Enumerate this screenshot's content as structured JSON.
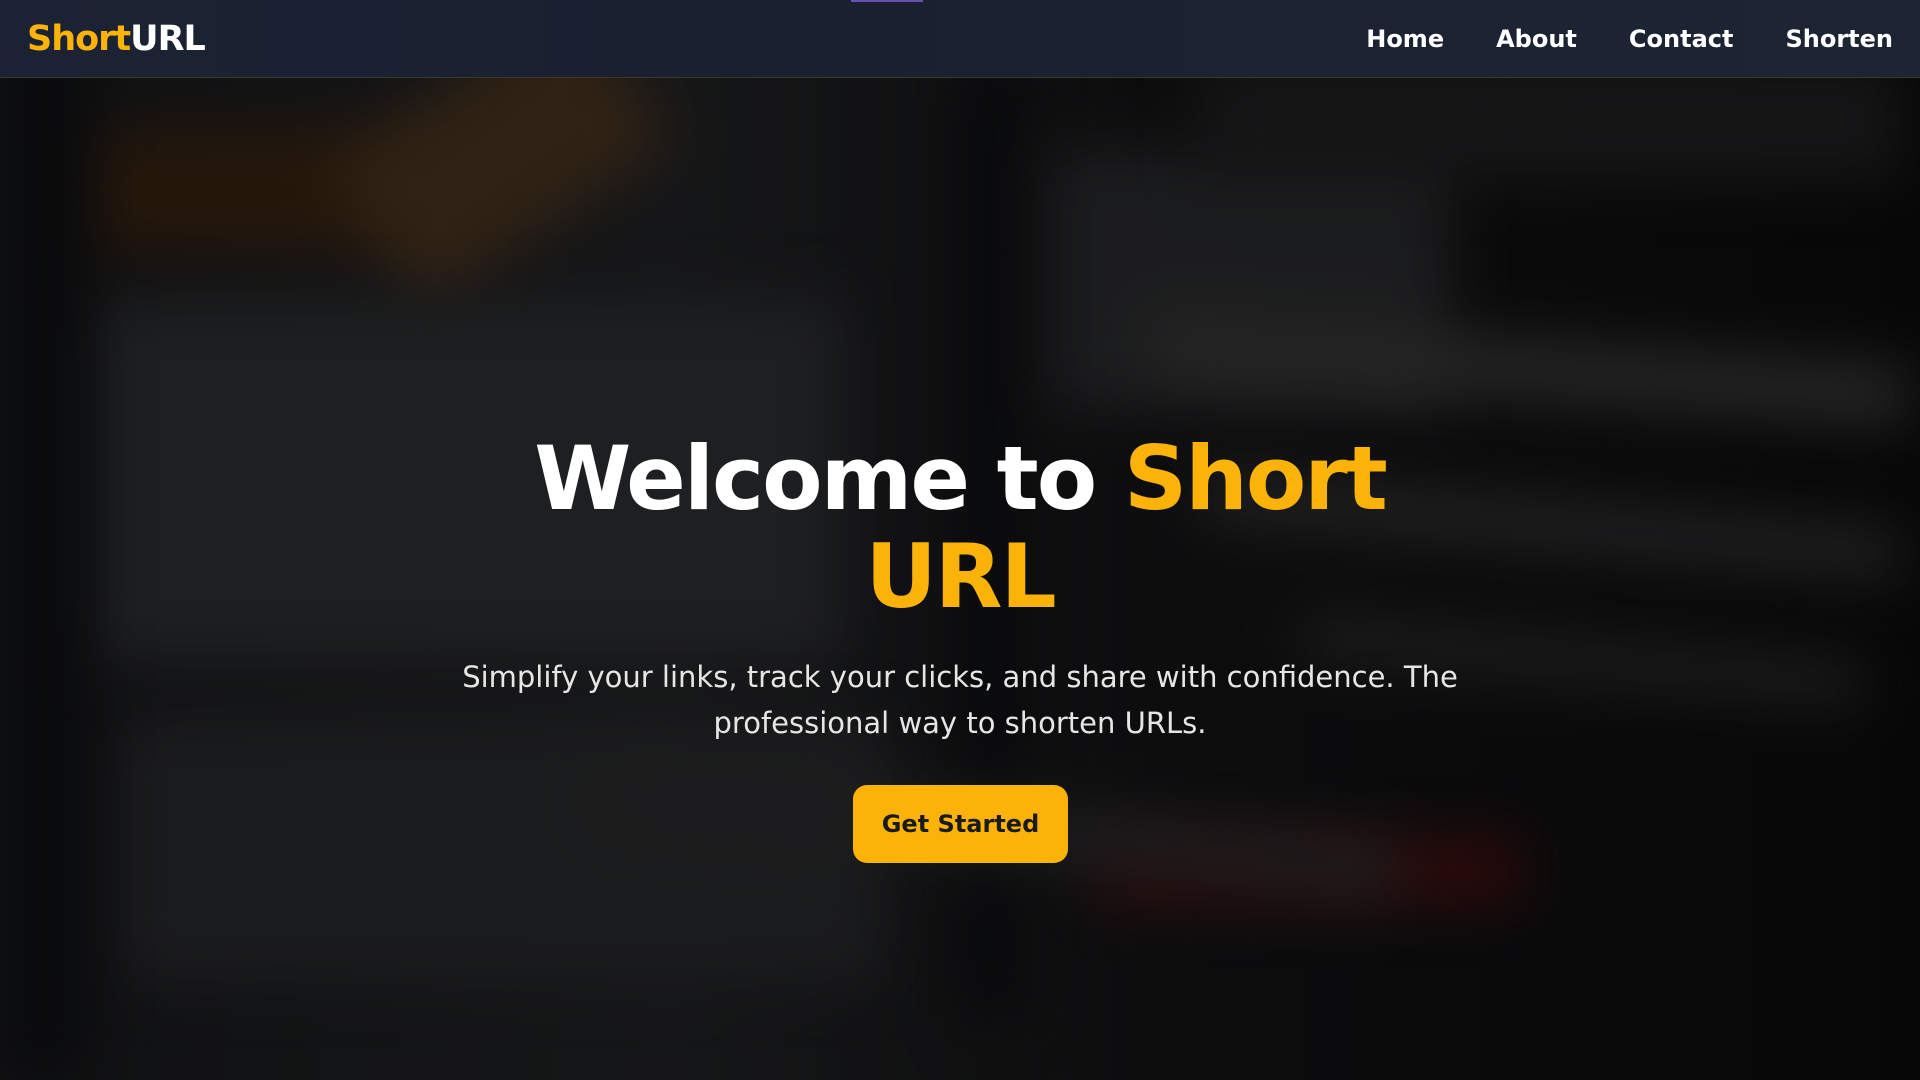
{
  "brand": {
    "part1": "Short",
    "part2": "URL",
    "accent_color": "#fbb30a"
  },
  "nav": {
    "items": [
      {
        "label": "Home"
      },
      {
        "label": "About"
      },
      {
        "label": "Contact"
      },
      {
        "label": "Shorten"
      }
    ]
  },
  "hero": {
    "title_prefix": "Welcome to ",
    "title_accent": "Short URL",
    "subtitle": "Simplify your links, track your clicks, and share with confidence. The professional way to shorten URLs.",
    "cta_label": "Get Started"
  },
  "colors": {
    "accent": "#fbb30a",
    "navbar_bg": "#1b2233",
    "text": "#ffffff"
  }
}
